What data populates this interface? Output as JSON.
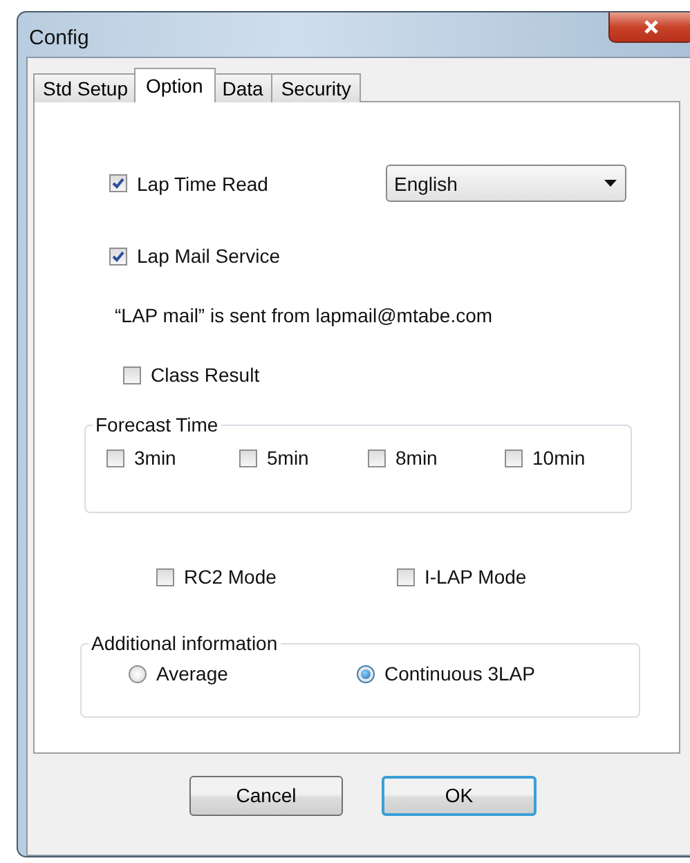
{
  "window": {
    "title": "Config"
  },
  "tabs": [
    {
      "label": "Std Setup",
      "selected": false
    },
    {
      "label": "Option",
      "selected": true
    },
    {
      "label": "Data",
      "selected": false
    },
    {
      "label": "Security",
      "selected": false
    }
  ],
  "lap_time_read": {
    "label": "Lap Time Read",
    "checked": true
  },
  "language": {
    "value": "English"
  },
  "lap_mail_service": {
    "label": "Lap Mail Service",
    "checked": true
  },
  "mail_note": "“LAP mail” is sent from lapmail@mtabe.com",
  "class_result": {
    "label": "Class Result",
    "checked": false
  },
  "forecast_time": {
    "title": "Forecast Time",
    "options": [
      {
        "label": "3min",
        "checked": false
      },
      {
        "label": "5min",
        "checked": false
      },
      {
        "label": "8min",
        "checked": false
      },
      {
        "label": "10min",
        "checked": false
      }
    ]
  },
  "modes": [
    {
      "label": "RC2 Mode",
      "checked": false
    },
    {
      "label": "I-LAP Mode",
      "checked": false
    }
  ],
  "additional_information": {
    "title": "Additional information",
    "options": [
      {
        "label": "Average",
        "selected": false
      },
      {
        "label": "Continuous 3LAP",
        "selected": true
      }
    ]
  },
  "buttons": [
    {
      "label": "Cancel",
      "default": false
    },
    {
      "label": "OK",
      "default": true
    }
  ]
}
